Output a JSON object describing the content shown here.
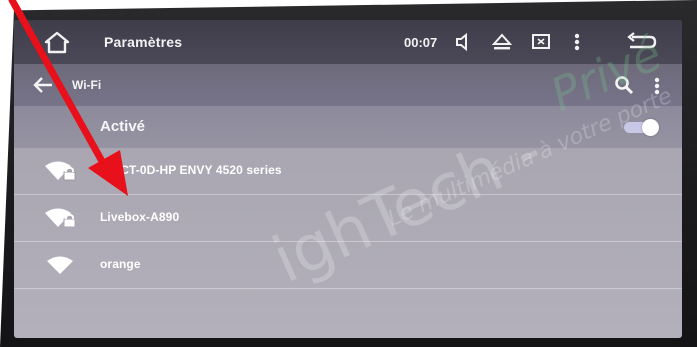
{
  "status_bar": {
    "title": "Paramètres",
    "time": "00:07",
    "icons": [
      "home-icon",
      "volume-icon",
      "eject-icon",
      "screen-icon",
      "more-vert-icon",
      "back-return-icon"
    ]
  },
  "toolbar": {
    "title": "Wi-Fi",
    "icons": [
      "back-arrow-icon",
      "search-icon",
      "more-vert-icon"
    ]
  },
  "wifi_toggle": {
    "label": "Activé",
    "enabled": true
  },
  "networks": [
    {
      "name": "…ECT-0D-HP ENVY 4520 series",
      "secured": true
    },
    {
      "name": "Livebox-A890",
      "secured": true
    },
    {
      "name": "orange",
      "secured": false
    }
  ],
  "watermark": {
    "main": "ighTech -",
    "tagline": "Le multimédia à votre porte",
    "prive": "Privé"
  },
  "colors": {
    "status_bar": "#45434f",
    "toolbar": "#726f82",
    "toggle_on": "#c6c8e6",
    "annotation_arrow": "#e8101a"
  }
}
